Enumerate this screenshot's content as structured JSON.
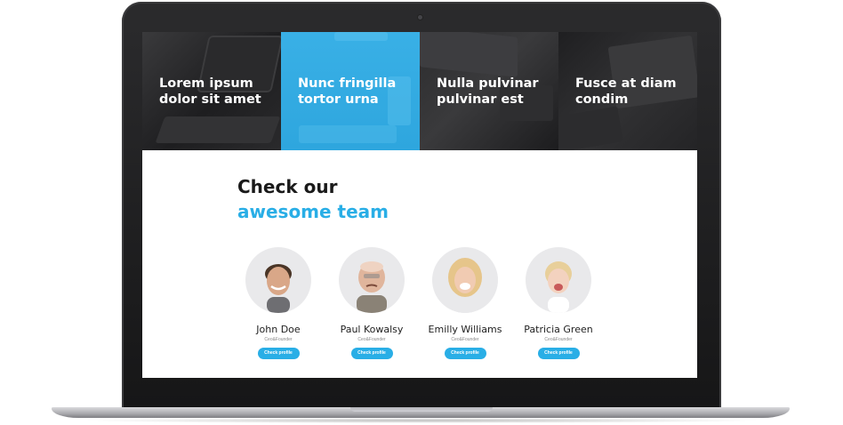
{
  "tiles": [
    {
      "title": "Lorem ipsum dolor sit amet"
    },
    {
      "title": "Nunc fringilla tortor urna"
    },
    {
      "title": "Nulla pulvinar pulvinar est"
    },
    {
      "title": "Fusce at diam condim"
    }
  ],
  "team": {
    "heading_line1": "Check our",
    "heading_line2": "awesome team",
    "members": [
      {
        "name": "John Doe",
        "role": "Ceo&Founder",
        "button": "Check profile"
      },
      {
        "name": "Paul Kowalsy",
        "role": "Ceo&Founder",
        "button": "Check profile"
      },
      {
        "name": "Emilly Williams",
        "role": "Ceo&Founder",
        "button": "Check profile"
      },
      {
        "name": "Patricia Green",
        "role": "Ceo&Founder",
        "button": "Check profile"
      }
    ]
  },
  "colors": {
    "accent": "#29aee6",
    "dark_text": "#1a1a1a"
  }
}
